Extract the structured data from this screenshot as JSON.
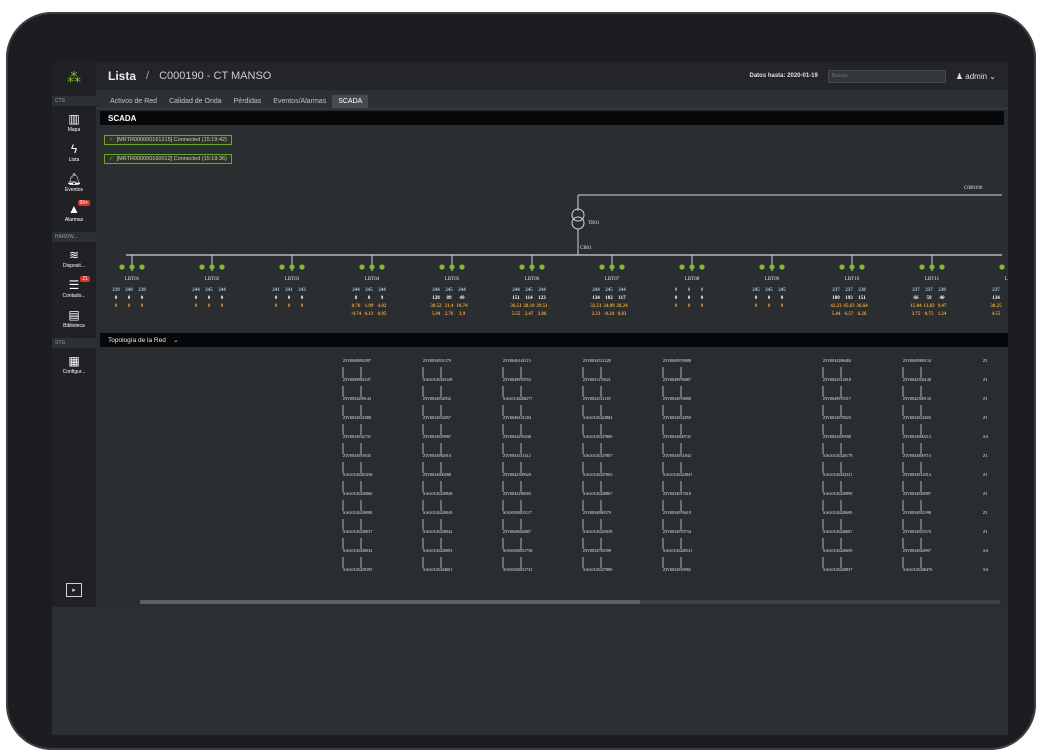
{
  "sidebar": {
    "logo_icon": "grid-dots-icon",
    "sections": [
      "CTS",
      "HARDW...",
      "STG"
    ],
    "items": [
      {
        "label": "Mapa",
        "icon": "map-icon",
        "glyph": "▥"
      },
      {
        "label": "Lista",
        "icon": "bolt-icon",
        "glyph": "ϟ"
      },
      {
        "label": "Eventos",
        "icon": "bell-icon",
        "glyph": "🔔︎"
      },
      {
        "label": "Alarmas",
        "icon": "warning-icon",
        "glyph": "▲",
        "badge": "99+"
      },
      {
        "label": "Disposit...",
        "icon": "signal-icon",
        "glyph": "≋"
      },
      {
        "label": "Contado...",
        "icon": "list-icon",
        "glyph": "☰",
        "badge": "21"
      },
      {
        "label": "Biblioteca",
        "icon": "document-icon",
        "glyph": "▤"
      },
      {
        "label": "Configur...",
        "icon": "config-icon",
        "glyph": "▦"
      }
    ]
  },
  "header": {
    "title": "Lista",
    "separator": "/",
    "subtitle": "C000190 - CT MANSO",
    "datos_label": "Datos hasta: 2020-01-19",
    "search_placeholder": "Buscar...",
    "user": "admin"
  },
  "tabs": [
    "Activos de Red",
    "Calidad de Onda",
    "Pérdidas",
    "Eventos/Alarmas",
    "SCADA"
  ],
  "active_tab": "SCADA",
  "panel_title": "SCADA",
  "connections": [
    "[MRTR000000161215] Connected (15:19:42)",
    "[MRTR000000160012] Connected (15:19:36)"
  ],
  "scada": {
    "station": "C000190",
    "transformer": "TR01",
    "breaker": "CB01",
    "lines": [
      {
        "name": "LBT01",
        "v": [
          "239",
          "240",
          "238"
        ],
        "i": [
          "0",
          "0",
          "0"
        ],
        "p": [
          "0",
          "0",
          "0"
        ]
      },
      {
        "name": "LBT02",
        "v": [
          "244",
          "245",
          "244"
        ],
        "i": [
          "0",
          "0",
          "0"
        ],
        "p": [
          "0",
          "0",
          "0"
        ]
      },
      {
        "name": "LBT03",
        "v": [
          "241",
          "241",
          "243"
        ],
        "i": [
          "0",
          "0",
          "0"
        ],
        "p": [
          "0",
          "0",
          "0"
        ]
      },
      {
        "name": "LBT04",
        "v": [
          "244",
          "245",
          "244"
        ],
        "i": [
          "8",
          "8",
          "9"
        ],
        "p": [
          "0.76",
          "1.99",
          "4.02"
        ],
        "q": [
          "-0.74",
          "0.13",
          "0.95"
        ]
      },
      {
        "name": "LBT05",
        "v": [
          "244",
          "245",
          "244"
        ],
        "i": [
          "128",
          "89",
          "49"
        ],
        "p": [
          "30.52",
          "21.4",
          "10.74"
        ],
        "q": [
          "5.94",
          "2.76",
          "3.9"
        ]
      },
      {
        "name": "LBT06",
        "v": [
          "244",
          "245",
          "244"
        ],
        "i": [
          "151",
          "114",
          "123"
        ],
        "p": [
          "36.51",
          "28.19",
          "29.51"
        ],
        "q": [
          "5.55",
          "2.47",
          "3.06"
        ]
      },
      {
        "name": "LBT07",
        "v": [
          "244",
          "245",
          "244"
        ],
        "i": [
          "134",
          "102",
          "117"
        ],
        "p": [
          "32.51",
          "24.89",
          "28.24"
        ],
        "q": [
          "2.23",
          "-0.24",
          "0.83"
        ]
      },
      {
        "name": "LBT08",
        "v": [
          "0",
          "0",
          "0"
        ],
        "i": [
          "0",
          "0",
          "0"
        ],
        "p": [
          "0",
          "0",
          "0"
        ]
      },
      {
        "name": "LBT09",
        "v": [
          "245",
          "245",
          "245"
        ],
        "i": [
          "0",
          "0",
          "0"
        ],
        "p": [
          "0",
          "0",
          "0"
        ]
      },
      {
        "name": "LBT10",
        "v": [
          "237",
          "237",
          "238"
        ],
        "i": [
          "180",
          "193",
          "151"
        ],
        "p": [
          "42.23",
          "45.63",
          "36.64"
        ],
        "q": [
          "5.44",
          "6.57",
          "6.26"
        ]
      },
      {
        "name": "LBT11",
        "v": [
          "237",
          "237",
          "238"
        ],
        "i": [
          "66",
          "59",
          "40"
        ],
        "p": [
          "15.04",
          "13.82",
          "9.47"
        ],
        "q": [
          "3.75",
          "0.75",
          "1.24"
        ]
      },
      {
        "name": "LBT12",
        "v": [
          "237"
        ],
        "i": [
          "134"
        ],
        "p": [
          "30.25"
        ],
        "q": [
          "4.55"
        ]
      }
    ]
  },
  "topology": {
    "label": "Topología de la Red",
    "columns": [
      [
        "ZIV0049881097",
        "ZIV0049881107",
        "ZIV0034299143",
        "ZIV0034821888",
        "ZIV0034932731",
        "ZIV0034919535",
        "SAG0145401238",
        "SAG0145420060",
        "SAG0145430008",
        "SAG0145430037",
        "SAG0145430032",
        "SAG0145429195"
      ],
      [
        "ZIV0034931379",
        "SAG0145435149",
        "ZIV0034932932",
        "ZIV0034932857",
        "ZIV0034929987",
        "ZIV0034982910",
        "ZIV0034600288",
        "SAG0145420948",
        "SAG0145420049",
        "SAG0145420042",
        "SAG0145420093",
        "SAG0145434001"
      ],
      [
        "ZIV0046142115",
        "ZIV0049970553",
        "SAG0136200277",
        "ZIV0049431204",
        "ZIV0034295436",
        "ZIV0034511412",
        "ZIV0042309920",
        "ZIV0042298583",
        "SOG0020031117",
        "ZIV0049604887",
        "SOG0020031738",
        "SOG0020031732"
      ],
      [
        "ZIV0034311228",
        "ZIV0031170621",
        "ZIV0034311118",
        "SAG0145422884",
        "SAG0145437800",
        "SAG0145437807",
        "SAG0145437003",
        "SAG0145420867",
        "ZIV0034880579",
        "SAG0145425039",
        "ZIV0034783399",
        "SAG0145437889"
      ],
      [
        "ZIV0049976888",
        "ZIV0049976887",
        "ZIV0034976800",
        "ZIV0034812859",
        "ZIV0034800741",
        "ZIV0034931842",
        "SAG0145422847",
        "ZIV0034017610",
        "ZIV0034976619",
        "ZIV0034970734",
        "SAG0145420521",
        "ZIV0034818982"
      ],
      null,
      [
        "ZIV0034286484",
        "ZIV0034312818",
        "ZIV0049970317",
        "ZIV0034978023",
        "ZIV0034309590",
        "SAG0145420179",
        "SAG0145432321",
        "SAG0145420999",
        "SAG0145420609",
        "SAG0145420687",
        "SAG0145420659",
        "SAG0145420837"
      ],
      [
        "ZIV0049980134",
        "ZIV0042304140",
        "ZIV0042300133",
        "ZIV0034812603",
        "ZIV0034900212",
        "ZIV0034809715",
        "ZIV0034812014",
        "ZIV0034928087",
        "ZIV0034925598",
        "ZIV0034925570",
        "ZIV0034924997",
        "SAG0145436476"
      ],
      [
        "ZI",
        "ZI",
        "ZI",
        "ZI",
        "SA",
        "ZI",
        "ZI",
        "ZI",
        "ZI",
        "ZI",
        "SA",
        "SA"
      ]
    ]
  },
  "colors": {
    "accent": "#7cbf2f",
    "alarm": "#d9342b",
    "value_current": "#ffffff",
    "value_voltage": "#9bc4e2",
    "value_power": "#e0a23a"
  }
}
